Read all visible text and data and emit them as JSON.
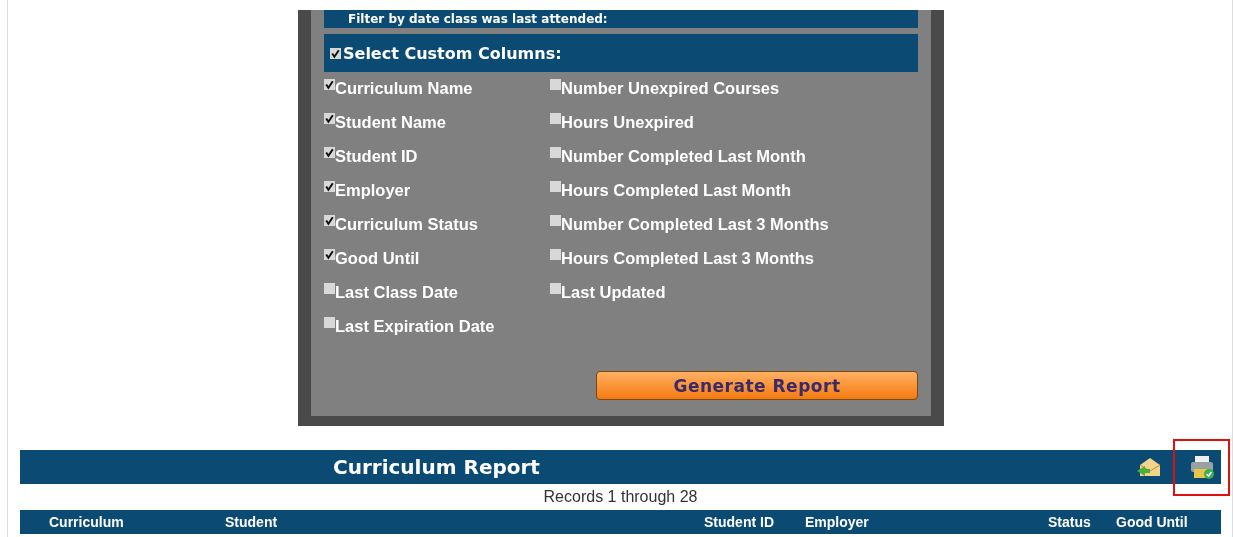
{
  "filter_header": {
    "label": "Filter by date class was last attended:"
  },
  "custom_columns": {
    "label": "Select Custom Columns:",
    "checked": true,
    "left": [
      {
        "label": "Curriculum Name",
        "checked": true
      },
      {
        "label": "Student Name",
        "checked": true
      },
      {
        "label": "Student ID",
        "checked": true
      },
      {
        "label": "Employer",
        "checked": true
      },
      {
        "label": "Curriculum Status",
        "checked": true
      },
      {
        "label": "Good Until",
        "checked": true
      },
      {
        "label": "Last Class Date",
        "checked": false
      },
      {
        "label": "Last Expiration Date",
        "checked": false
      }
    ],
    "right": [
      {
        "label": "Number Unexpired Courses",
        "checked": false
      },
      {
        "label": "Hours Unexpired",
        "checked": false
      },
      {
        "label": "Number Completed Last Month",
        "checked": false
      },
      {
        "label": "Hours Completed Last Month",
        "checked": false
      },
      {
        "label": "Number Completed Last 3 Months",
        "checked": false
      },
      {
        "label": "Hours Completed Last 3 Months",
        "checked": false
      },
      {
        "label": "Last Updated",
        "checked": false
      }
    ]
  },
  "generate_button": "Generate Report",
  "report": {
    "title": "Curriculum Report",
    "records": "Records 1 through 28",
    "print_highlighted": true,
    "columns": [
      "Curriculum",
      "Student",
      "Student ID",
      "Employer",
      "Status",
      "Good Until"
    ]
  }
}
